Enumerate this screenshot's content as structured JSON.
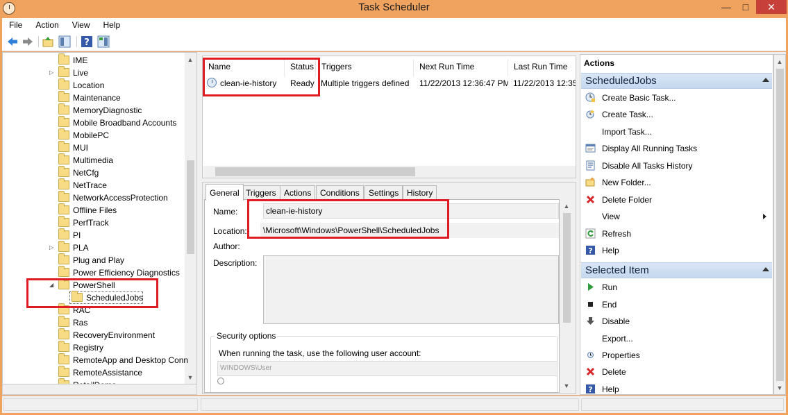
{
  "window": {
    "title": "Task Scheduler"
  },
  "menu": [
    "File",
    "Action",
    "View",
    "Help"
  ],
  "tree": {
    "items": [
      {
        "label": "IME",
        "expandable": false
      },
      {
        "label": "Live",
        "expandable": true
      },
      {
        "label": "Location",
        "expandable": false
      },
      {
        "label": "Maintenance",
        "expandable": false
      },
      {
        "label": "MemoryDiagnostic",
        "expandable": false
      },
      {
        "label": "Mobile Broadband Accounts",
        "expandable": false
      },
      {
        "label": "MobilePC",
        "expandable": false
      },
      {
        "label": "MUI",
        "expandable": false
      },
      {
        "label": "Multimedia",
        "expandable": false
      },
      {
        "label": "NetCfg",
        "expandable": false
      },
      {
        "label": "NetTrace",
        "expandable": false
      },
      {
        "label": "NetworkAccessProtection",
        "expandable": false
      },
      {
        "label": "Offline Files",
        "expandable": false
      },
      {
        "label": "PerfTrack",
        "expandable": false
      },
      {
        "label": "PI",
        "expandable": false
      },
      {
        "label": "PLA",
        "expandable": true
      },
      {
        "label": "Plug and Play",
        "expandable": false
      },
      {
        "label": "Power Efficiency Diagnostics",
        "expandable": false
      },
      {
        "label": "PowerShell",
        "expandable": true,
        "expanded": true
      },
      {
        "label": "ScheduledJobs",
        "expandable": false,
        "child": true,
        "selected": true
      },
      {
        "label": "RAC",
        "expandable": false
      },
      {
        "label": "Ras",
        "expandable": false
      },
      {
        "label": "RecoveryEnvironment",
        "expandable": false
      },
      {
        "label": "Registry",
        "expandable": false
      },
      {
        "label": "RemoteApp and Desktop Conn",
        "expandable": false
      },
      {
        "label": "RemoteAssistance",
        "expandable": false
      },
      {
        "label": "RetailDemo",
        "expandable": false
      }
    ]
  },
  "task_list": {
    "columns": [
      "Name",
      "Status",
      "Triggers",
      "Next Run Time",
      "Last Run Time"
    ],
    "rows": [
      {
        "name": "clean-ie-history",
        "status": "Ready",
        "triggers": "Multiple triggers defined",
        "next_run": "11/22/2013 12:36:47 PM",
        "last_run": "11/22/2013 12:35"
      }
    ]
  },
  "details": {
    "tabs": [
      "General",
      "Triggers",
      "Actions",
      "Conditions",
      "Settings",
      "History"
    ],
    "active_tab": "General",
    "name_label": "Name:",
    "name_value": "clean-ie-history",
    "location_label": "Location:",
    "location_value": "\\Microsoft\\Windows\\PowerShell\\ScheduledJobs",
    "author_label": "Author:",
    "description_label": "Description:",
    "security_title": "Security options",
    "security_text": "When running the task, use the following user account:",
    "account_value": "WINDOWS\\User"
  },
  "actions_pane": {
    "title": "Actions",
    "sections": [
      {
        "name": "ScheduledJobs",
        "items": [
          {
            "label": "Create Basic Task...",
            "icon": "create-basic-task-icon"
          },
          {
            "label": "Create Task...",
            "icon": "create-task-icon"
          },
          {
            "label": "Import Task...",
            "icon": ""
          },
          {
            "label": "Display All Running Tasks",
            "icon": "running-tasks-icon"
          },
          {
            "label": "Disable All Tasks History",
            "icon": "history-icon"
          },
          {
            "label": "New Folder...",
            "icon": "new-folder-icon"
          },
          {
            "label": "Delete Folder",
            "icon": "delete-icon"
          },
          {
            "label": "View",
            "icon": "",
            "submenu": true
          },
          {
            "label": "Refresh",
            "icon": "refresh-icon"
          },
          {
            "label": "Help",
            "icon": "help-icon"
          }
        ]
      },
      {
        "name": "Selected Item",
        "items": [
          {
            "label": "Run",
            "icon": "run-icon"
          },
          {
            "label": "End",
            "icon": "end-icon"
          },
          {
            "label": "Disable",
            "icon": "disable-icon"
          },
          {
            "label": "Export...",
            "icon": ""
          },
          {
            "label": "Properties",
            "icon": "properties-icon"
          },
          {
            "label": "Delete",
            "icon": "delete-icon"
          },
          {
            "label": "Help",
            "icon": "help-icon"
          }
        ]
      }
    ]
  },
  "colors": {
    "title_bar": "#f0a35f",
    "highlight": "#e01b24",
    "section_header": "#c5d8ef"
  }
}
